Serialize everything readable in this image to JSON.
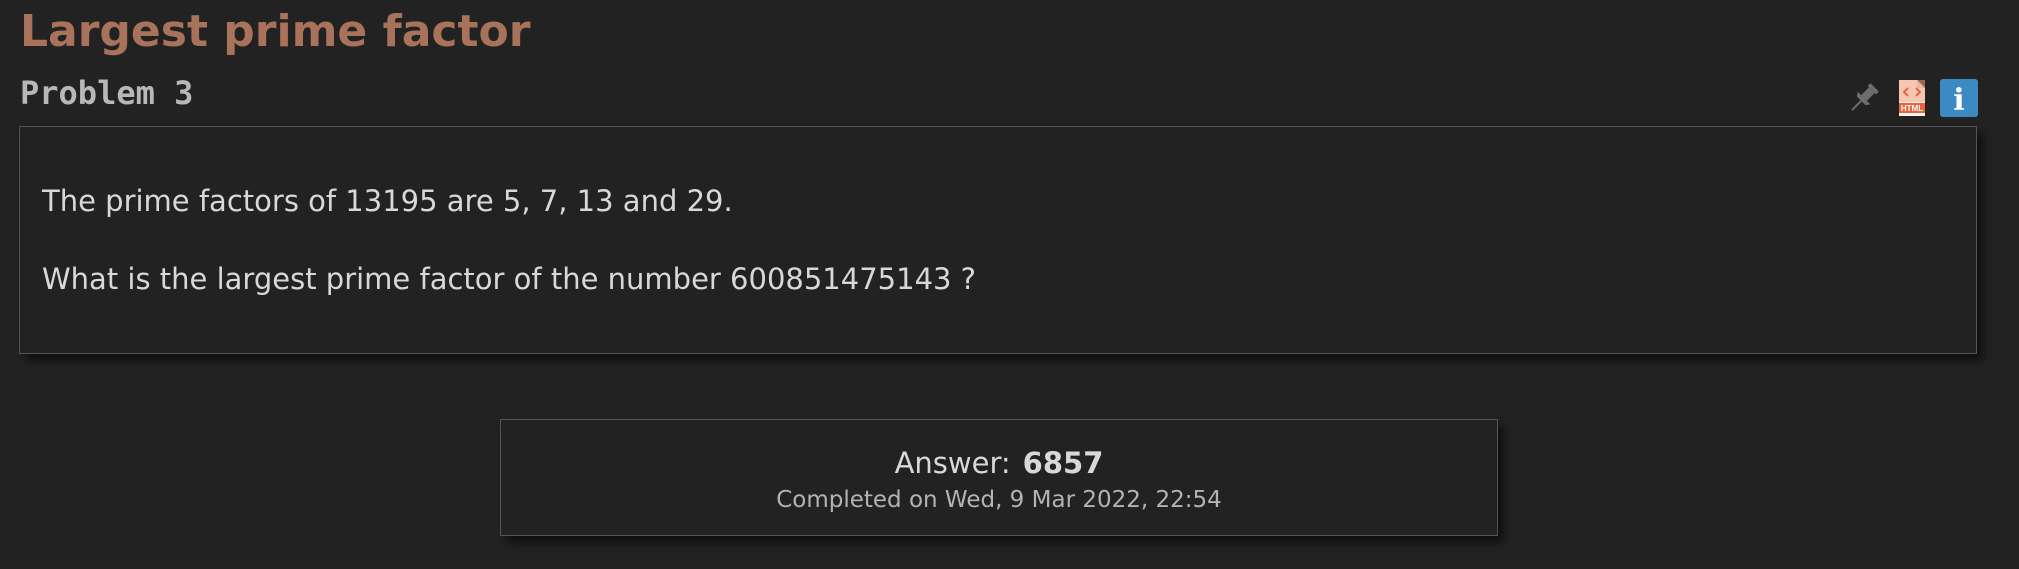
{
  "problem": {
    "title": "Largest prime factor",
    "number_label": "Problem 3",
    "paragraphs": [
      "The prime factors of 13195 are 5, 7, 13 and 29.",
      "What is the largest prime factor of the number 600851475143 ?"
    ]
  },
  "toolbar": {
    "items": [
      {
        "icon": "pin-icon",
        "color": "#6e6e6e"
      },
      {
        "icon": "html-file-icon",
        "label": "HTML",
        "color": "#e8643c"
      },
      {
        "icon": "info-icon",
        "label": "i",
        "color": "#3b8ac4"
      }
    ]
  },
  "answer": {
    "label": "Answer:",
    "value": "6857",
    "completed": "Completed on Wed, 9 Mar 2022, 22:54"
  },
  "colors": {
    "background": "#222222",
    "title": "#a8735a",
    "text": "#d8d8d8",
    "border": "#555555"
  }
}
